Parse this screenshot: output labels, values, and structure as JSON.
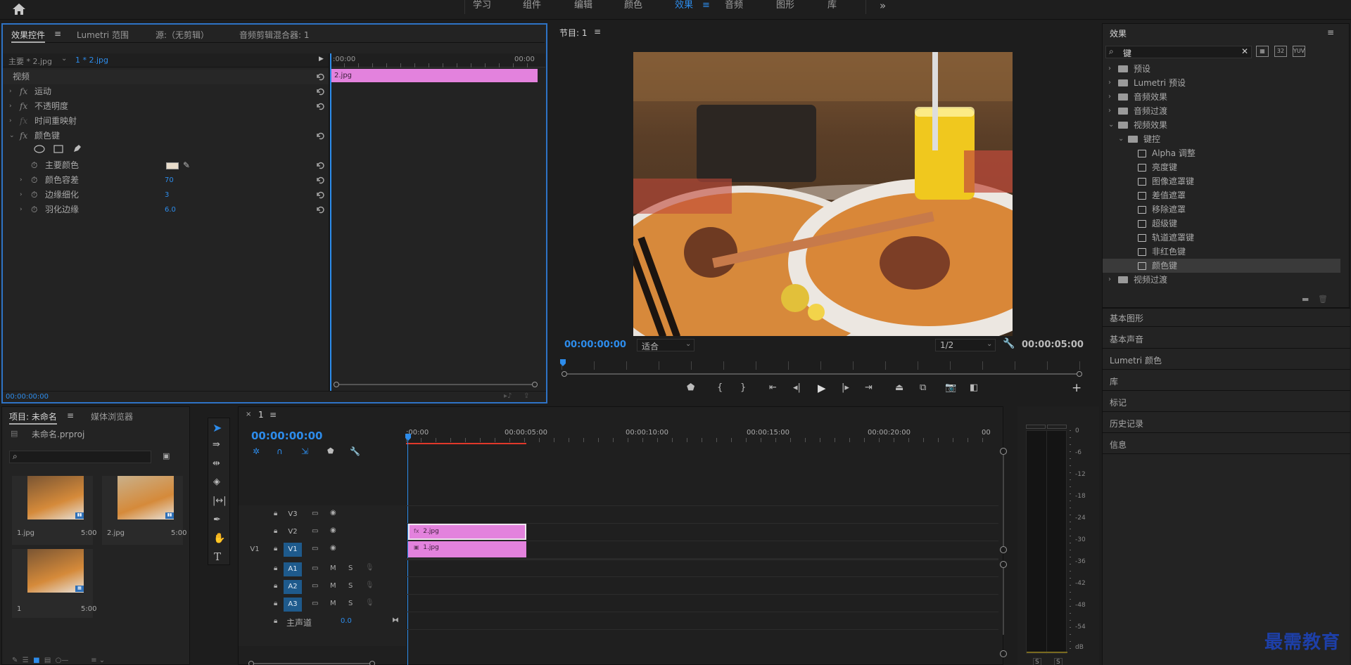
{
  "workspaces": [
    "学习",
    "组件",
    "编辑",
    "颜色",
    "效果",
    "音频",
    "图形",
    "库"
  ],
  "active_workspace": "效果",
  "effect_controls": {
    "tabs": [
      "效果控件",
      "Lumetri 范围",
      "源:（无剪辑）",
      "音频剪辑混合器: 1"
    ],
    "master": "主要 * 2.jpg",
    "clip": "1 * 2.jpg",
    "time_start": ":00:00",
    "time_end": "00:00",
    "clip_bar_label": "2.jpg",
    "section_video": "视频",
    "effects": [
      {
        "name": "运动"
      },
      {
        "name": "不透明度"
      },
      {
        "name": "时间重映射"
      },
      {
        "name": "颜色键"
      }
    ],
    "params": [
      {
        "name": "主要颜色",
        "value": ""
      },
      {
        "name": "颜色容差",
        "value": "70"
      },
      {
        "name": "边缘细化",
        "value": "3"
      },
      {
        "name": "羽化边缘",
        "value": "6.0"
      }
    ],
    "bottom_time": "00:00:00:00"
  },
  "program": {
    "title": "节目: 1",
    "timecode": "00:00:00:00",
    "fit": "适合",
    "resolution": "1/2",
    "duration": "00:00:05:00"
  },
  "effects_panel": {
    "title": "效果",
    "search_value": "键",
    "tree": [
      {
        "label": "预设",
        "level": 0,
        "type": "folder"
      },
      {
        "label": "Lumetri 预设",
        "level": 0,
        "type": "folder"
      },
      {
        "label": "音频效果",
        "level": 0,
        "type": "folder"
      },
      {
        "label": "音频过渡",
        "level": 0,
        "type": "folder"
      },
      {
        "label": "视频效果",
        "level": 0,
        "type": "folder",
        "open": true
      },
      {
        "label": "键控",
        "level": 1,
        "type": "folder",
        "open": true
      },
      {
        "label": "Alpha 调整",
        "level": 2,
        "type": "fx"
      },
      {
        "label": "亮度键",
        "level": 2,
        "type": "fx"
      },
      {
        "label": "图像遮罩键",
        "level": 2,
        "type": "fx"
      },
      {
        "label": "差值遮罩",
        "level": 2,
        "type": "fx"
      },
      {
        "label": "移除遮罩",
        "level": 2,
        "type": "fx"
      },
      {
        "label": "超级键",
        "level": 2,
        "type": "fx"
      },
      {
        "label": "轨道遮罩键",
        "level": 2,
        "type": "fx"
      },
      {
        "label": "非红色键",
        "level": 2,
        "type": "fx"
      },
      {
        "label": "颜色键",
        "level": 2,
        "type": "fx",
        "selected": true
      },
      {
        "label": "视频过渡",
        "level": 0,
        "type": "folder"
      }
    ],
    "side_panels": [
      "基本图形",
      "基本声音",
      "Lumetri 颜色",
      "库",
      "标记",
      "历史记录",
      "信息"
    ]
  },
  "project": {
    "tabs": [
      "项目: 未命名",
      "媒体浏览器"
    ],
    "file": "未命名.prproj",
    "items": [
      {
        "name": "1.jpg",
        "duration": "5:00"
      },
      {
        "name": "2.jpg",
        "duration": "5:00"
      },
      {
        "name": "1",
        "duration": "5:00"
      }
    ]
  },
  "timeline": {
    "tab": "1",
    "timecode": "00:00:00:00",
    "ruler": [
      ":00:00",
      "00:00:05:00",
      "00:00:10:00",
      "00:00:15:00",
      "00:00:20:00",
      "00"
    ],
    "video_tracks": [
      {
        "name": "V3",
        "src": ""
      },
      {
        "name": "V2",
        "src": ""
      },
      {
        "name": "V1",
        "src": "V1"
      }
    ],
    "audio_tracks": [
      "A1",
      "A2",
      "A3"
    ],
    "master": {
      "label": "主声道",
      "value": "0.0"
    },
    "clips": [
      {
        "label": "2.jpg",
        "track": "V2"
      },
      {
        "label": "1.jpg",
        "track": "V1"
      }
    ]
  },
  "meter": {
    "labels": [
      "0",
      "-6",
      "-12",
      "-18",
      "-24",
      "-30",
      "-36",
      "-42",
      "-48",
      "-54",
      "dB"
    ],
    "solo": [
      "S",
      "S"
    ]
  },
  "watermark": "最需教育",
  "colors": {
    "accent": "#2d8ceb",
    "clip": "#e382dd",
    "track_active": "#1e5a8c"
  }
}
